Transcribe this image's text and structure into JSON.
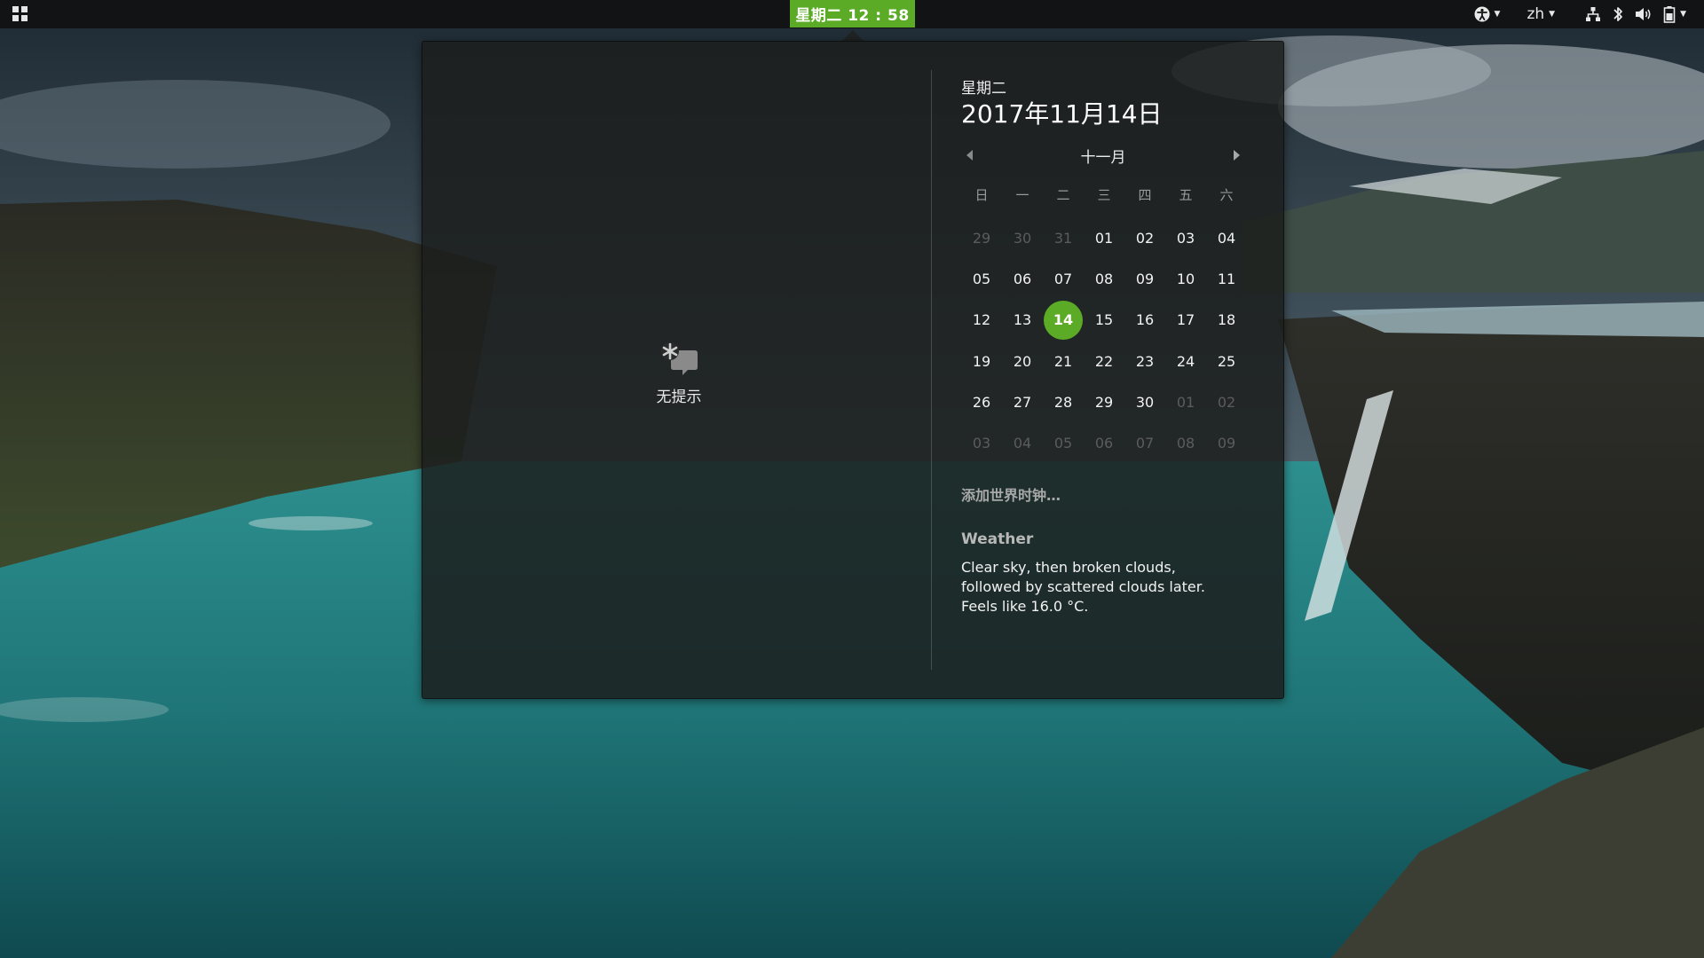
{
  "panel": {
    "clock": "星期二 12 : 58",
    "language": "zh"
  },
  "notifications": {
    "empty_label": "无提示"
  },
  "calendar": {
    "day_name": "星期二",
    "full_date": "2017年11月14日",
    "month_label": "十一月",
    "weekdays": [
      "日",
      "一",
      "二",
      "三",
      "四",
      "五",
      "六"
    ],
    "weeks": [
      [
        "29",
        "30",
        "31",
        "01",
        "02",
        "03",
        "04"
      ],
      [
        "05",
        "06",
        "07",
        "08",
        "09",
        "10",
        "11"
      ],
      [
        "12",
        "13",
        "14",
        "15",
        "16",
        "17",
        "18"
      ],
      [
        "19",
        "20",
        "21",
        "22",
        "23",
        "24",
        "25"
      ],
      [
        "26",
        "27",
        "28",
        "29",
        "30",
        "01",
        "02"
      ],
      [
        "03",
        "04",
        "05",
        "06",
        "07",
        "08",
        "09"
      ]
    ],
    "other_month_days": [
      [
        0,
        0
      ],
      [
        0,
        1
      ],
      [
        0,
        2
      ],
      [
        4,
        5
      ],
      [
        4,
        6
      ],
      [
        5,
        0
      ],
      [
        5,
        1
      ],
      [
        5,
        2
      ],
      [
        5,
        3
      ],
      [
        5,
        4
      ],
      [
        5,
        5
      ],
      [
        5,
        6
      ]
    ],
    "today": [
      2,
      2
    ]
  },
  "world_clock_label": "添加世界时钟…",
  "weather": {
    "title": "Weather",
    "line1": "Clear sky, then broken clouds,",
    "line2": "followed by scattered clouds later.",
    "line3": "Feels like 16.0 °C."
  },
  "colors": {
    "accent": "#5bab27",
    "panel_bg": "#111314",
    "popover_bg": "#1c1e1d"
  },
  "icons": {
    "apps": "apps-grid-icon",
    "accessibility": "accessibility-icon",
    "network": "network-icon",
    "bluetooth": "bluetooth-icon",
    "volume": "volume-icon",
    "battery": "battery-icon",
    "no_notifications": "no-notifications-icon"
  }
}
